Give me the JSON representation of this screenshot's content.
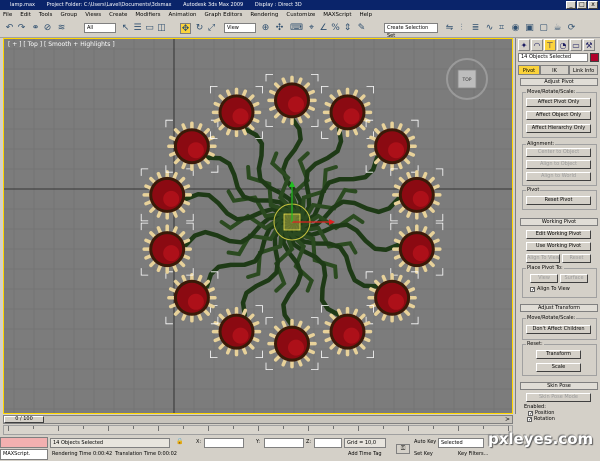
{
  "window": {
    "file": "lamp.max",
    "project": "Project Folder: C:\\Users\\Lavel\\Documents\\3dsmax",
    "app": "Autodesk 3ds Max 2009",
    "display": "Display : Direct 3D",
    "min": "_",
    "max": "□",
    "close": "x"
  },
  "menu": [
    "File",
    "Edit",
    "Tools",
    "Group",
    "Views",
    "Create",
    "Modifiers",
    "Animation",
    "Graph Editors",
    "Rendering",
    "Customize",
    "MAXScript",
    "Help"
  ],
  "toolbar": {
    "filter": "All",
    "coord_system": "View",
    "named_selection": "Create Selection Set"
  },
  "viewport": {
    "label": "[ + ] [ Top ] [ Smooth + Highlights ]",
    "viewcube": "TOP"
  },
  "command_panel": {
    "selection_field": "14 Objects Selected",
    "tabs": [
      "Pivot",
      "IK",
      "Link Info"
    ],
    "adjust_pivot": {
      "title": "Adjust Pivot",
      "group_move": "Move/Rotate/Scale:",
      "affect_pivot": "Affect Pivot Only",
      "affect_object": "Affect Object Only",
      "affect_hierarchy": "Affect Hierarchy Only",
      "group_alignment": "Alignment:",
      "center_to_object": "Center to Object",
      "align_to_object": "Align to Object",
      "align_to_world": "Align to World",
      "group_pivot": "Pivot",
      "reset_pivot": "Reset Pivot"
    },
    "working_pivot": {
      "title": "Working Pivot",
      "edit": "Edit Working Pivot",
      "use": "Use Working Pivot",
      "align_to_view": "Align To View",
      "reset": "Reset",
      "place_pivot_to": "Place Pivot To:",
      "view": "View",
      "surface": "Surface",
      "align_to_view_chk": "Align To View"
    },
    "adjust_transform": {
      "title": "Adjust Transform",
      "group_move": "Move/Rotate/Scale:",
      "dont_affect_children": "Don't Affect Children",
      "group_reset": "Reset:",
      "transform": "Transform",
      "scale": "Scale"
    },
    "skin_pose": {
      "title": "Skin Pose",
      "mode": "Skin Pose Mode",
      "enabled": "Enabled:",
      "position": "Position",
      "rotation": "Rotation"
    }
  },
  "time_slider": {
    "label": "0 / 100",
    "arrow": ">"
  },
  "status_bar": {
    "selected": "14 Objects Selected",
    "render_time": "Rendering Time  0:00:42",
    "translation_time": "Translation Time  0:00:02",
    "x_label": "X:",
    "y_label": "Y:",
    "z_label": "Z:",
    "grid": "Grid = 10,0",
    "add_time_tag": "Add Time Tag",
    "auto_key": "Auto Key",
    "set_key": "Set Key",
    "selected_dropdown": "Selected",
    "key_filters": "Key Filters...",
    "maxscript": "MAXScript."
  },
  "watermark": "pxleyes.com",
  "colors": {
    "viewport_bg": "#7c7c7c",
    "active_border": "#ffd700",
    "flower_petal": "#e8d29a",
    "flower_center": "#8b0a12",
    "stem": "#1e3a16",
    "selection_bracket": "#ffffff",
    "title_bar": "#0a246a",
    "active_tab": "#fbd33b"
  }
}
